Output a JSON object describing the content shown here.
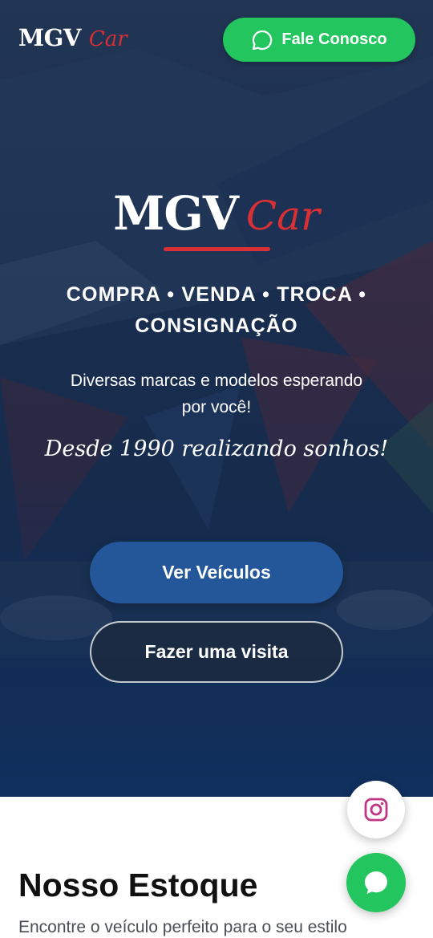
{
  "header": {
    "brand": {
      "main": "MGV",
      "accent": "Car"
    },
    "cta_label": "Fale Conosco",
    "cta_icon": "whatsapp-chat-icon"
  },
  "hero": {
    "logo": {
      "main": "MGV",
      "accent": "Car"
    },
    "services_line1": "COMPRA • VENDA • TROCA •",
    "services_line2": "CONSIGNAÇÃO",
    "tagline_line1": "Diversas marcas e modelos esperando",
    "tagline_line2": "por você!",
    "since": "Desde 1990 realizando sonhos!",
    "primary_button": "Ver Veículos",
    "secondary_button": "Fazer uma visita"
  },
  "floating": {
    "instagram_icon": "instagram-icon",
    "whatsapp_icon": "whatsapp-icon"
  },
  "stock": {
    "title": "Nosso Estoque",
    "subtitle": "Encontre o veículo perfeito para o seu estilo"
  },
  "colors": {
    "accent_red": "#d93035",
    "cta_green": "#22c55e",
    "primary_blue": "#23579a"
  }
}
